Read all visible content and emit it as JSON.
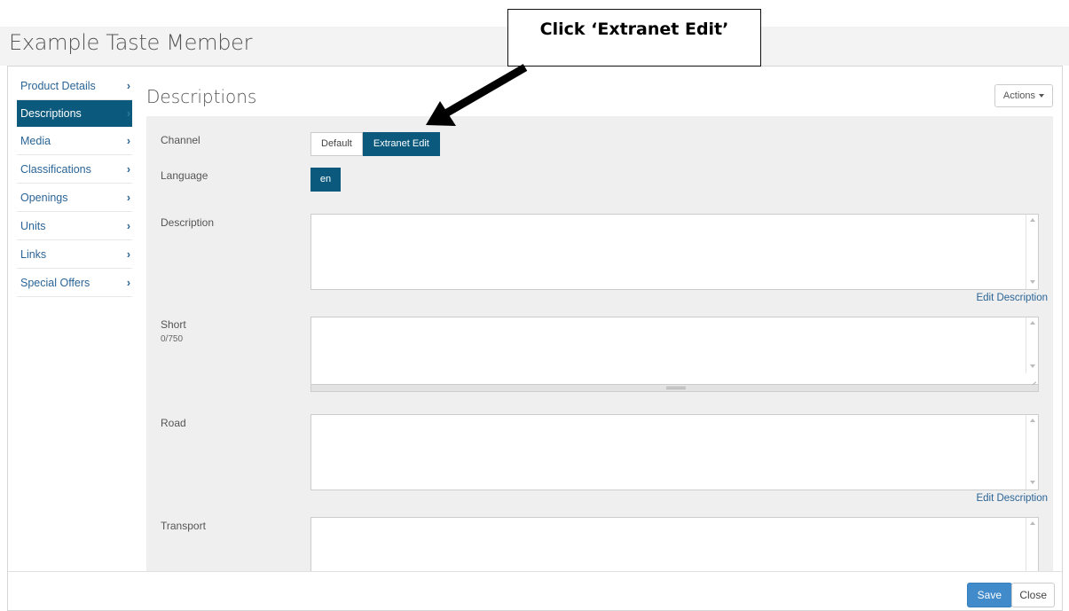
{
  "page": {
    "title": "Example Taste Member"
  },
  "sidebar": {
    "items": [
      {
        "label": "Product Details"
      },
      {
        "label": "Descriptions"
      },
      {
        "label": "Media"
      },
      {
        "label": "Classifications"
      },
      {
        "label": "Openings"
      },
      {
        "label": "Units"
      },
      {
        "label": "Links"
      },
      {
        "label": "Special Offers"
      }
    ],
    "active_index": 1,
    "chevron": "›"
  },
  "content": {
    "title": "Descriptions",
    "actions_label": "Actions"
  },
  "form": {
    "channel_label": "Channel",
    "channel_options": [
      "Default",
      "Extranet Edit"
    ],
    "channel_selected": "Extranet Edit",
    "language_label": "Language",
    "language_value": "en",
    "description_label": "Description",
    "description_value": "",
    "edit_description_label": "Edit Description",
    "short_label": "Short",
    "short_counter": "0/750",
    "short_value": "",
    "road_label": "Road",
    "road_value": "",
    "transport_label": "Transport",
    "transport_value": ""
  },
  "footer": {
    "save_label": "Save",
    "close_label": "Close"
  },
  "annotation": {
    "callout_text": "Click ‘Extranet Edit’"
  },
  "colors": {
    "primary": "#0b5a7e",
    "link": "#2a6496",
    "save": "#428bca"
  }
}
